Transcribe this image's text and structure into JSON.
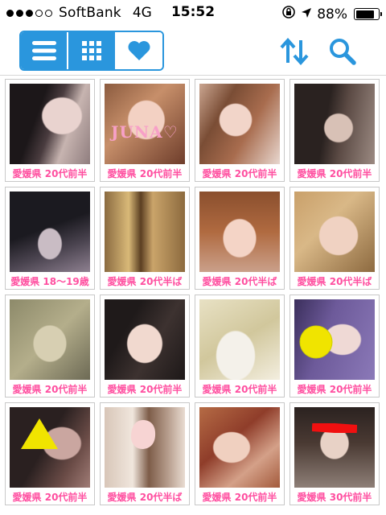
{
  "status_bar": {
    "carrier": "SoftBank",
    "network": "4G",
    "time": "15:52",
    "battery": "88%",
    "battery_level": 0.88,
    "signal_bars_filled": 3,
    "signal_bars_total": 5
  },
  "toolbar": {
    "view_modes": [
      {
        "name": "list-view",
        "icon": "list-icon",
        "active": false
      },
      {
        "name": "grid-view",
        "icon": "grid-icon",
        "active": false
      },
      {
        "name": "favorites-view",
        "icon": "heart-icon",
        "active": true
      }
    ],
    "actions": [
      "sort-icon",
      "search-icon"
    ]
  },
  "colors": {
    "accent": "#2a96dd",
    "caption": "#ff4fa0"
  },
  "profiles": [
    {
      "caption": "愛媛県 20代前半",
      "photo_overlay": ""
    },
    {
      "caption": "愛媛県 20代前半",
      "photo_overlay": "JUNA♡"
    },
    {
      "caption": "愛媛県 20代前半",
      "photo_overlay": ""
    },
    {
      "caption": "愛媛県 20代前半",
      "photo_overlay": ""
    },
    {
      "caption": "愛媛県 18〜19歳",
      "photo_overlay": ""
    },
    {
      "caption": "愛媛県 20代半ば",
      "photo_overlay": ""
    },
    {
      "caption": "愛媛県 20代半ば",
      "photo_overlay": ""
    },
    {
      "caption": "愛媛県 20代半ば",
      "photo_overlay": ""
    },
    {
      "caption": "愛媛県 20代前半",
      "photo_overlay": ""
    },
    {
      "caption": "愛媛県 20代前半",
      "photo_overlay": ""
    },
    {
      "caption": "愛媛県 20代前半",
      "photo_overlay": ""
    },
    {
      "caption": "愛媛県 20代前半",
      "photo_overlay": ""
    },
    {
      "caption": "愛媛県 20代前半",
      "photo_overlay": ""
    },
    {
      "caption": "愛媛県 20代半ば",
      "photo_overlay": ""
    },
    {
      "caption": "愛媛県 20代前半",
      "photo_overlay": ""
    },
    {
      "caption": "愛媛県 30代前半",
      "photo_overlay": ""
    }
  ]
}
